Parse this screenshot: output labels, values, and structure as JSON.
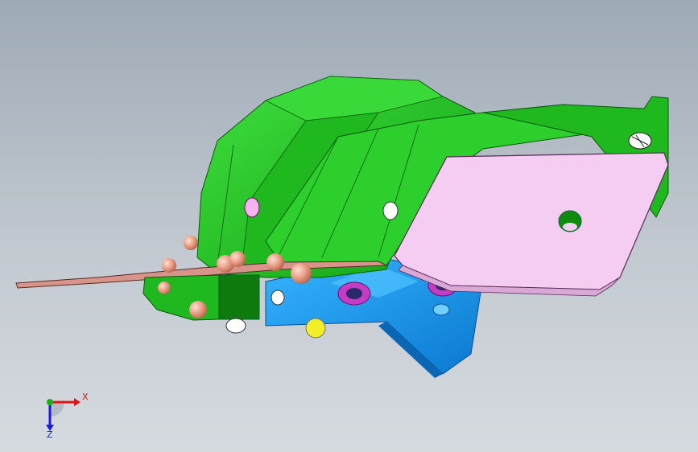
{
  "viewport": {
    "background_top": "#9eaab6",
    "background_bottom": "#d6dbe0"
  },
  "model": {
    "colors": {
      "green_part": "#22c422",
      "green_dark": "#159a15",
      "pink_plate": "#f6cdf2",
      "blue_part": "#1e9ff0",
      "blue_dark": "#0c6fc4",
      "copper_strip": "#c7847a",
      "rivet": "#e8a28c",
      "magenta_hole": "#d12fd1",
      "yellow_fastener": "#f2ef2a",
      "dark_green_block": "#0e7a0e"
    }
  },
  "triad": {
    "x_label": "X",
    "z_label": "Z",
    "x_color": "#e01414",
    "z_color": "#1a1ae6",
    "y_color": "#14b414"
  }
}
